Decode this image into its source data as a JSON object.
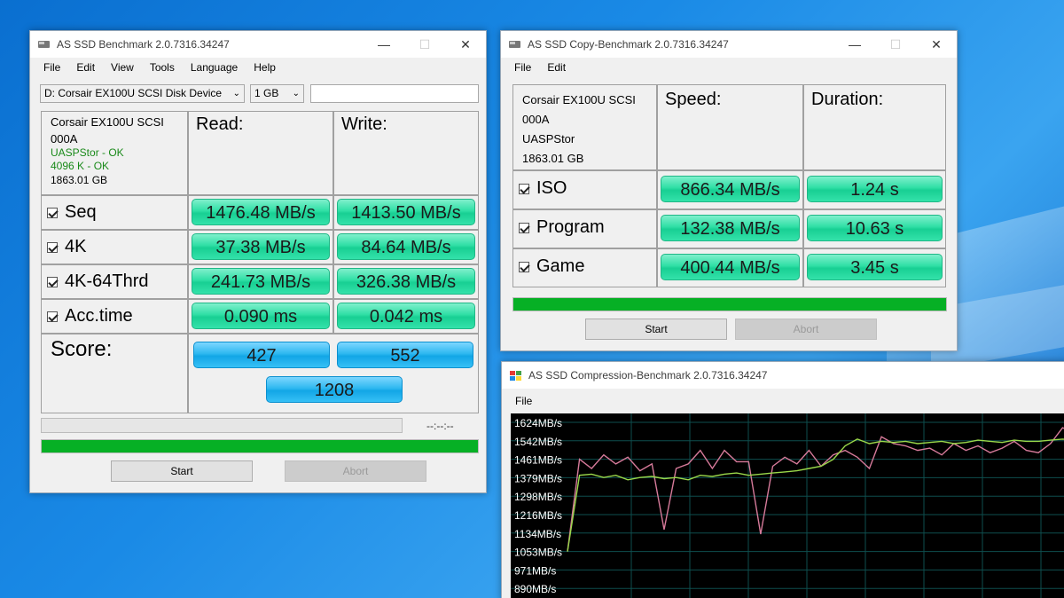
{
  "main": {
    "title": "AS SSD Benchmark 2.0.7316.34247",
    "menu": [
      "File",
      "Edit",
      "View",
      "Tools",
      "Language",
      "Help"
    ],
    "drive_select": "D: Corsair EX100U SCSI Disk Device",
    "size_select": "1 GB",
    "device": {
      "line1": "Corsair EX100U SCSI",
      "line2": "000A",
      "driver": "UASPStor - OK",
      "align": "4096 K - OK",
      "capacity": "1863.01 GB"
    },
    "headers": {
      "read": "Read:",
      "write": "Write:"
    },
    "rows": [
      {
        "label": "Seq",
        "read": "1476.48 MB/s",
        "write": "1413.50 MB/s"
      },
      {
        "label": "4K",
        "read": "37.38 MB/s",
        "write": "84.64 MB/s"
      },
      {
        "label": "4K-64Thrd",
        "read": "241.73 MB/s",
        "write": "326.38 MB/s"
      },
      {
        "label": "Acc.time",
        "read": "0.090 ms",
        "write": "0.042 ms"
      }
    ],
    "score_label": "Score:",
    "score_read": "427",
    "score_write": "552",
    "score_total": "1208",
    "time_display": "--:--:--",
    "start": "Start",
    "abort": "Abort"
  },
  "copy": {
    "title": "AS SSD Copy-Benchmark 2.0.7316.34247",
    "menu": [
      "File",
      "Edit"
    ],
    "device": {
      "line1": "Corsair EX100U SCSI",
      "line2": "000A",
      "line3": "UASPStor",
      "line4": "1863.01 GB"
    },
    "headers": {
      "speed": "Speed:",
      "duration": "Duration:"
    },
    "rows": [
      {
        "label": "ISO",
        "speed": "866.34 MB/s",
        "duration": "1.24 s"
      },
      {
        "label": "Program",
        "speed": "132.38 MB/s",
        "duration": "10.63 s"
      },
      {
        "label": "Game",
        "speed": "400.44 MB/s",
        "duration": "3.45 s"
      }
    ],
    "start": "Start",
    "abort": "Abort"
  },
  "compression": {
    "title": "AS SSD Compression-Benchmark 2.0.7316.34247",
    "menu": [
      "File"
    ],
    "chart_data": {
      "type": "line",
      "ylabels": [
        "1624MB/s",
        "1542MB/s",
        "1461MB/s",
        "1379MB/s",
        "1298MB/s",
        "1216MB/s",
        "1134MB/s",
        "1053MB/s",
        "971MB/s",
        "890MB/s"
      ],
      "ylim": [
        890,
        1624
      ],
      "series": [
        {
          "color": "#d67a9a",
          "values": [
            1053,
            1461,
            1420,
            1480,
            1440,
            1470,
            1410,
            1440,
            1150,
            1420,
            1440,
            1500,
            1420,
            1500,
            1450,
            1450,
            1130,
            1430,
            1470,
            1440,
            1500,
            1430,
            1480,
            1500,
            1470,
            1420,
            1560,
            1530,
            1520,
            1500,
            1510,
            1480,
            1530,
            1500,
            1520,
            1490,
            1510,
            1540,
            1500,
            1490,
            1530,
            1600,
            1580
          ]
        },
        {
          "color": "#9ad84a",
          "values": [
            1053,
            1390,
            1395,
            1380,
            1390,
            1370,
            1380,
            1385,
            1375,
            1380,
            1370,
            1390,
            1385,
            1395,
            1400,
            1390,
            1395,
            1400,
            1405,
            1410,
            1420,
            1430,
            1460,
            1520,
            1550,
            1530,
            1540,
            1535,
            1540,
            1530,
            1535,
            1540,
            1530,
            1535,
            1545,
            1540,
            1535,
            1545,
            1540,
            1540,
            1545,
            1550,
            1545
          ]
        }
      ],
      "grid": true
    }
  }
}
